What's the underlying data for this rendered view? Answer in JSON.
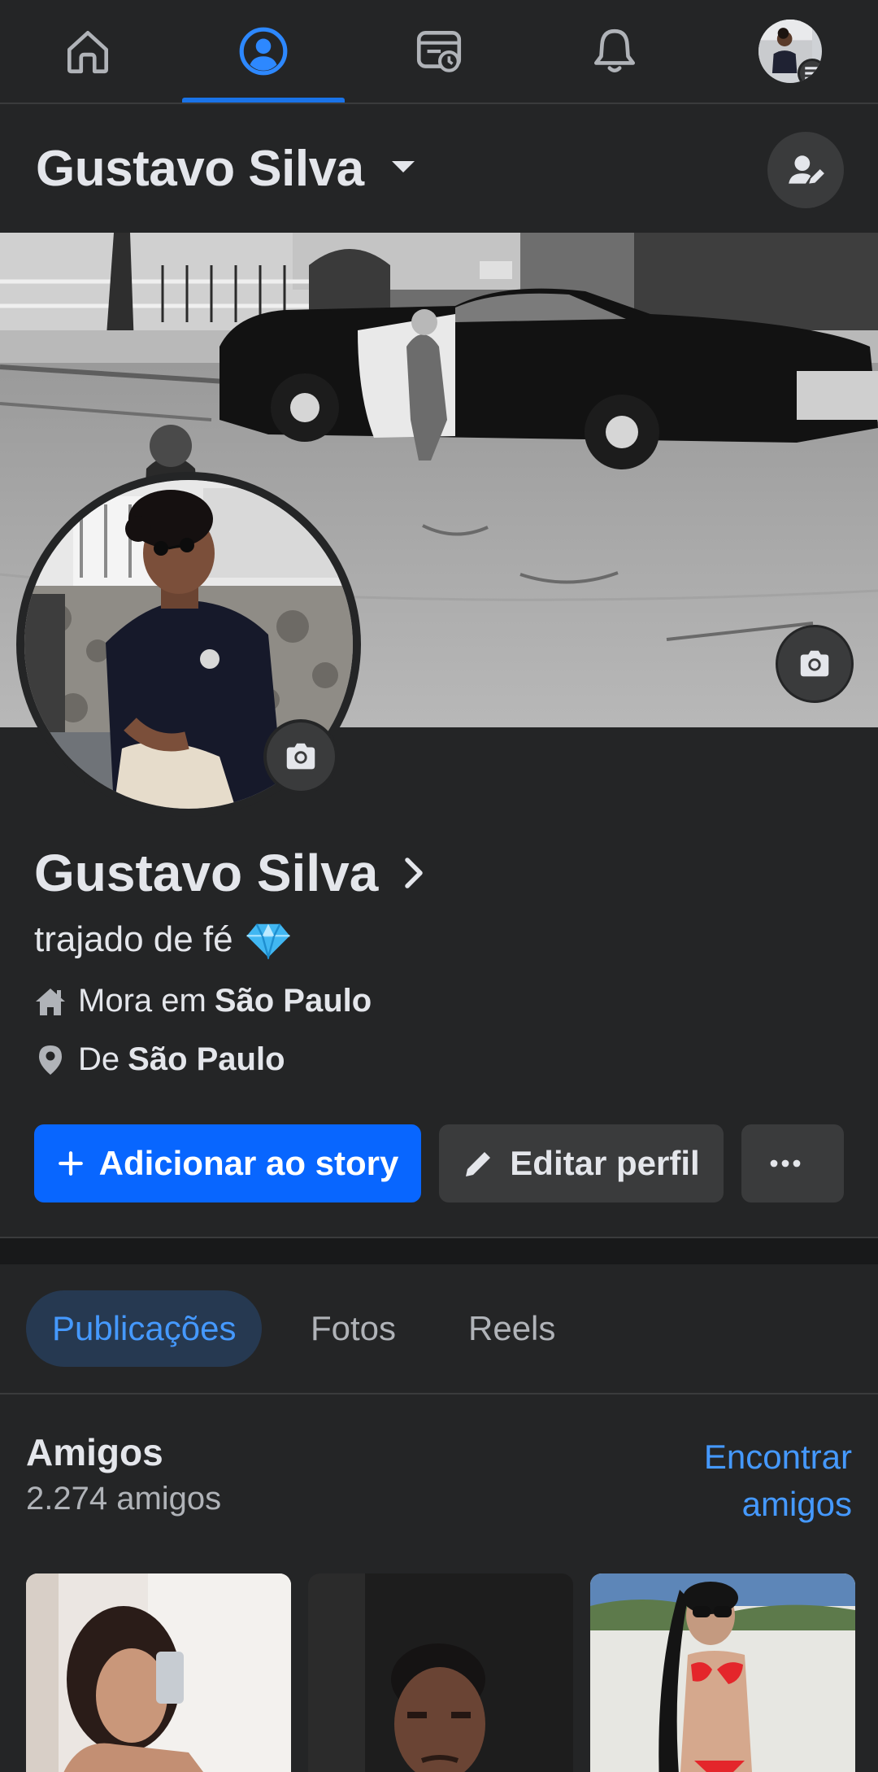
{
  "nav": {
    "tabs": [
      {
        "name": "home",
        "icon": "home-icon"
      },
      {
        "name": "profile",
        "icon": "profile-icon",
        "active": true
      },
      {
        "name": "watch",
        "icon": "watch-icon"
      },
      {
        "name": "notifications",
        "icon": "bell-icon"
      },
      {
        "name": "menu",
        "icon": "avatar-menu"
      }
    ]
  },
  "header": {
    "title": "Gustavo Silva"
  },
  "profile": {
    "name": "Gustavo Silva",
    "bio": "trajado de fé",
    "bio_emoji": "💎",
    "lives_prefix": "Mora em",
    "lives_city": "São Paulo",
    "from_prefix": "De",
    "from_city": "São Paulo"
  },
  "actions": {
    "add_story": "Adicionar ao story",
    "edit_profile": "Editar perfil",
    "more": "···"
  },
  "tabs": [
    {
      "label": "Publicações",
      "active": true
    },
    {
      "label": "Fotos"
    },
    {
      "label": "Reels"
    }
  ],
  "friends": {
    "title": "Amigos",
    "count": "2.274 amigos",
    "find_line1": "Encontrar",
    "find_line2": "amigos"
  },
  "colors": {
    "background": "#242526",
    "primary": "#0866ff",
    "accent_text": "#4599ff"
  }
}
